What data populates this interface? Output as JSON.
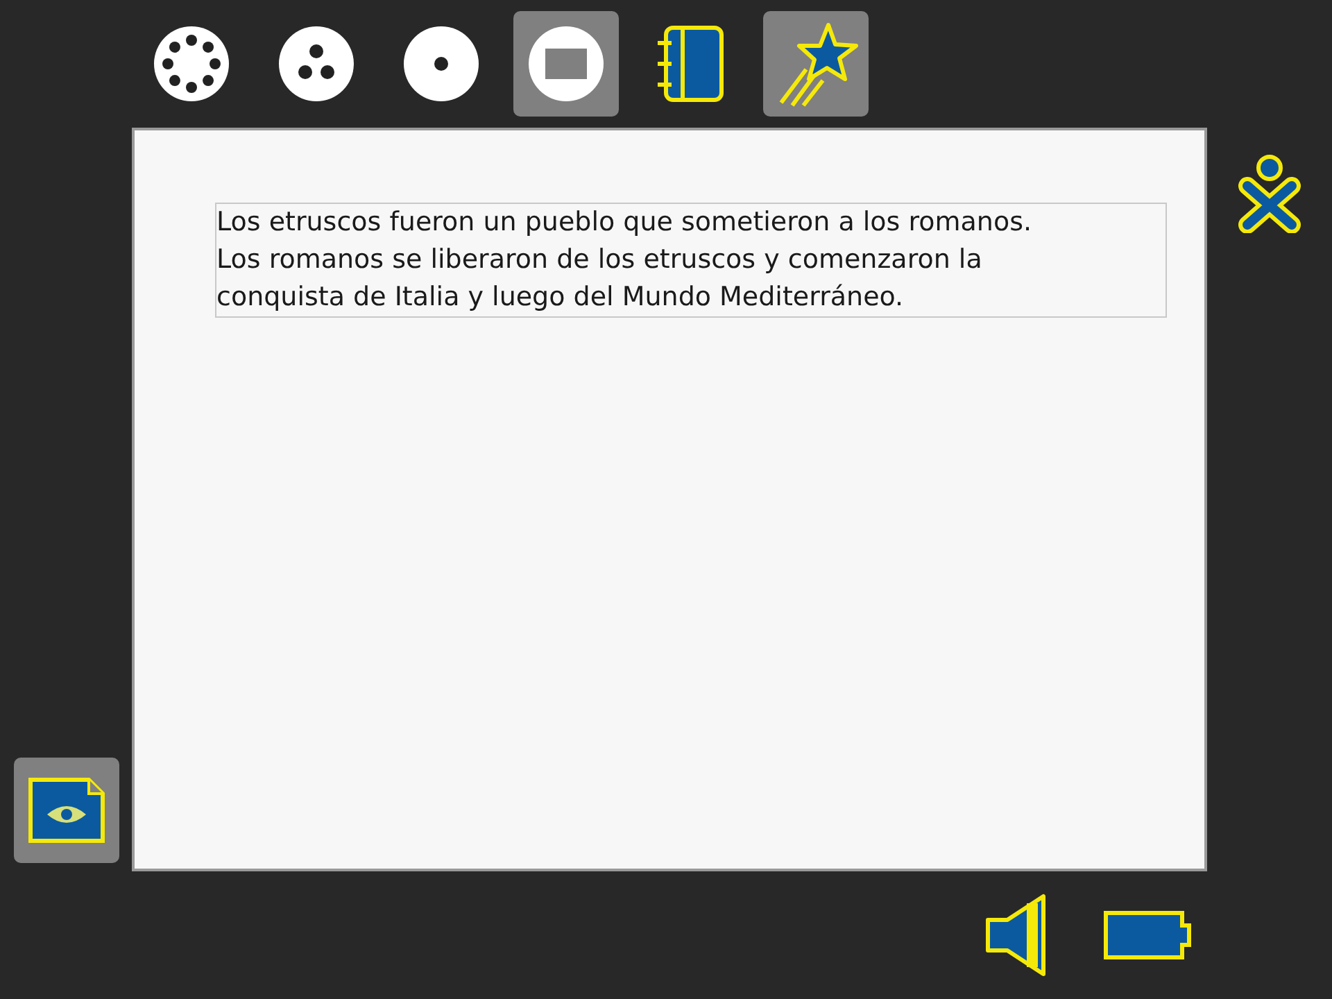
{
  "top_bar": {
    "views": [
      {
        "kind": "neighborhood",
        "selected": false
      },
      {
        "kind": "group",
        "selected": false
      },
      {
        "kind": "home",
        "selected": false
      },
      {
        "kind": "activity",
        "selected": true
      }
    ],
    "activities": [
      {
        "kind": "journal",
        "selected": false
      },
      {
        "kind": "star",
        "selected": true
      }
    ]
  },
  "document": {
    "lines": [
      "Los etruscos fueron un pueblo que sometieron a los romanos.",
      "Los romanos se liberaron de los etruscos y comenzaron la",
      "conquista de Italia y luego del Mundo Mediterráneo."
    ]
  },
  "clipboard": [
    {
      "kind": "document",
      "selected": true
    }
  ],
  "devices": [
    {
      "kind": "speaker"
    },
    {
      "kind": "battery"
    }
  ]
}
